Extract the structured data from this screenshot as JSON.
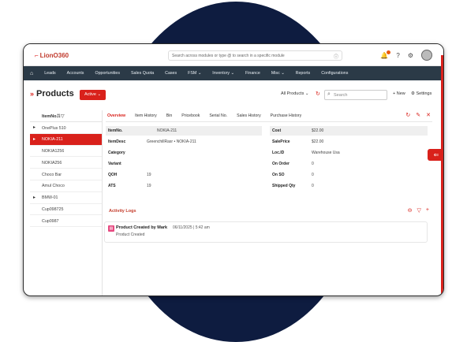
{
  "topbar": {
    "logo": "LionO360",
    "search_placeholder": "Search across modules or type @ to search in a specific module",
    "icons": [
      "notification-bell-icon",
      "help-icon",
      "settings-gear-icon",
      "avatar"
    ]
  },
  "nav": {
    "items": [
      "Leads",
      "Accounts",
      "Opportunities",
      "Sales Quota",
      "Cases",
      "FSM",
      "Inventory",
      "Finance",
      "Misc",
      "Reports",
      "Configurations"
    ]
  },
  "page": {
    "title": "Products",
    "status": "Active",
    "view_selector": "All Products",
    "search_placeholder": "Search",
    "new_label": "+ New",
    "settings_label": "Settings"
  },
  "list": {
    "header": "ItemNo.",
    "items": [
      {
        "label": "OnePlus 510",
        "expandable": true,
        "selected": false
      },
      {
        "label": "NOKIA-211",
        "expandable": true,
        "selected": true
      },
      {
        "label": "NOKIA1256",
        "expandable": false,
        "selected": false
      },
      {
        "label": "NOKIA256",
        "expandable": false,
        "selected": false
      },
      {
        "label": "Choco Bar",
        "expandable": false,
        "selected": false
      },
      {
        "label": "Amul Choco",
        "expandable": false,
        "selected": false
      },
      {
        "label": "BMW-01",
        "expandable": true,
        "selected": false
      },
      {
        "label": "Cup098725",
        "expandable": false,
        "selected": false
      },
      {
        "label": "Cup0987",
        "expandable": false,
        "selected": false
      }
    ]
  },
  "tabs": [
    "Overview",
    "Item History",
    "Bin",
    "Pricebook",
    "Serial No.",
    "Sales History",
    "Purchase History"
  ],
  "details_left": [
    {
      "label": "ItemNo.",
      "value": "NOKIA-211"
    },
    {
      "label": "ItemDesc",
      "value": "GreenchillRasr • NOKIA-211"
    },
    {
      "label": "Category",
      "value": ""
    },
    {
      "label": "Variant",
      "value": ""
    },
    {
      "label": "QOH",
      "value": "19"
    },
    {
      "label": "ATS",
      "value": "19"
    }
  ],
  "details_right": [
    {
      "label": "Cost",
      "value": "$22.00"
    },
    {
      "label": "SalePrice",
      "value": "$22.00"
    },
    {
      "label": "Loc.ID",
      "value": "Warehouse Usa"
    },
    {
      "label": "On Order",
      "value": "0"
    },
    {
      "label": "On SO",
      "value": "0"
    },
    {
      "label": "Shipped Qty",
      "value": "0"
    }
  ],
  "activity": {
    "title": "Activity Logs",
    "entry": {
      "title": "Product Created by Mark",
      "time": "06/11/2025 | 5:42 am",
      "sub": "Product Created"
    }
  },
  "colors": {
    "accent": "#d9211b",
    "nav_bg": "#2b3a47",
    "backdrop_circle": "#0e1c40"
  }
}
